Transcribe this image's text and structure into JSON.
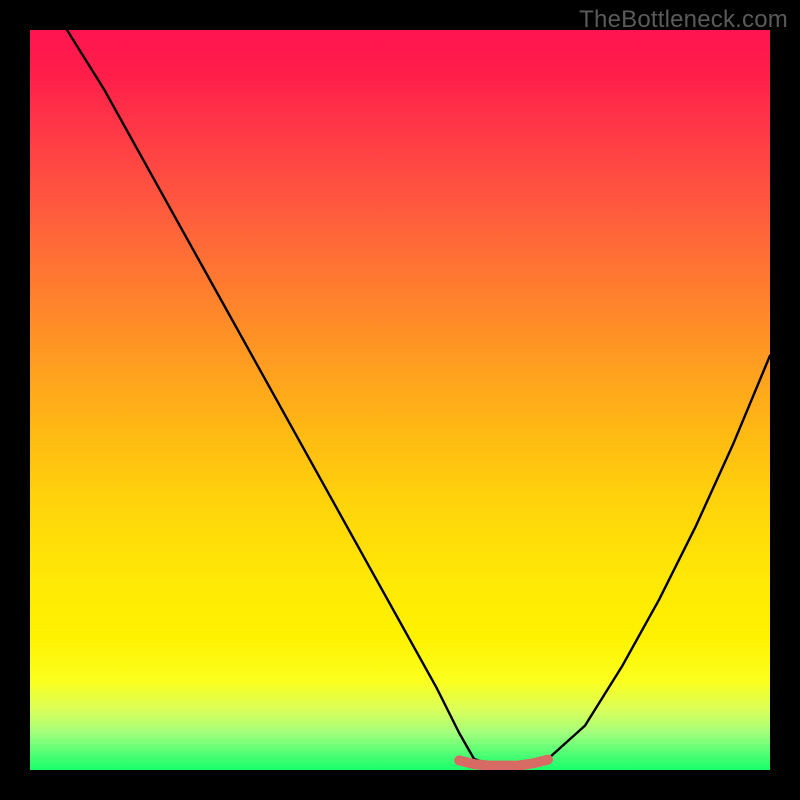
{
  "watermark": "TheBottleneck.com",
  "chart_data": {
    "type": "line",
    "title": "",
    "xlabel": "",
    "ylabel": "",
    "xlim": [
      0,
      100
    ],
    "ylim": [
      0,
      100
    ],
    "grid": false,
    "legend": false,
    "gradient_colors": {
      "top": "#ff1450",
      "mid_upper": "#ff9a22",
      "mid_lower": "#ffe806",
      "bottom": "#16ff6a"
    },
    "series": [
      {
        "name": "bottleneck-curve",
        "stroke": "#000000",
        "x": [
          5,
          10,
          15,
          20,
          25,
          30,
          35,
          40,
          45,
          50,
          55,
          58,
          60,
          62,
          65,
          68,
          70,
          75,
          80,
          85,
          90,
          95,
          100
        ],
        "values": [
          100,
          92,
          83,
          74,
          65,
          56,
          47,
          38,
          29,
          20,
          11,
          5,
          1.5,
          0.8,
          0.6,
          0.8,
          1.5,
          6,
          14,
          23,
          33,
          44,
          56
        ]
      },
      {
        "name": "flat-minimum-marker",
        "stroke": "#d86a64",
        "x": [
          58,
          60,
          62,
          64,
          66,
          68,
          70
        ],
        "values": [
          1.3,
          0.8,
          0.6,
          0.6,
          0.6,
          0.9,
          1.4
        ]
      }
    ],
    "minimum": {
      "x_range": [
        58,
        70
      ],
      "value": 0.6
    }
  }
}
